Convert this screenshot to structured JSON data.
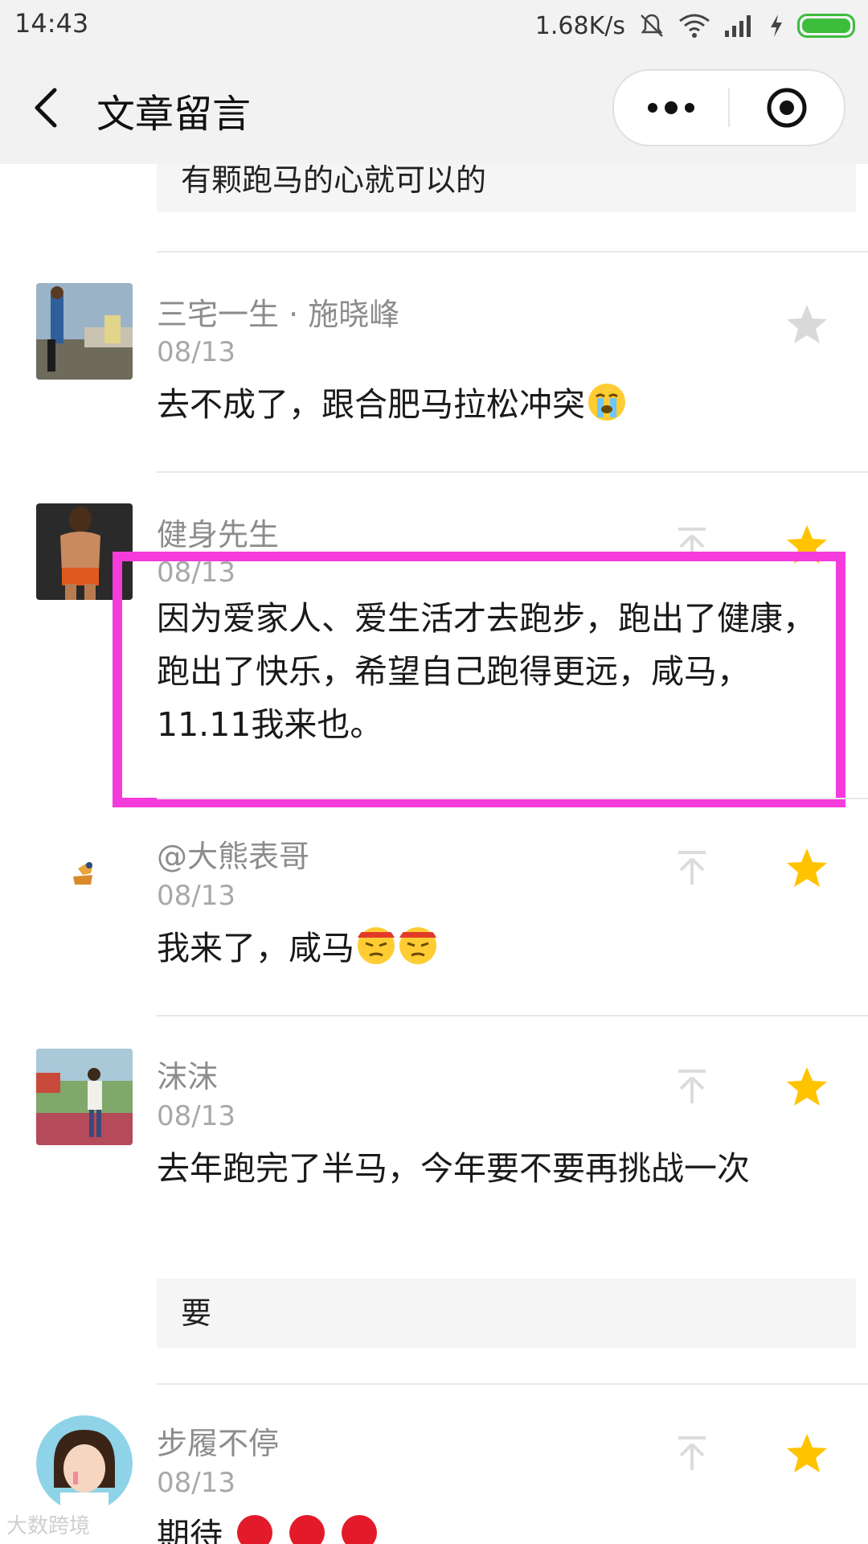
{
  "status_bar": {
    "time": "14:43",
    "speed": "1.68K/s",
    "battery_color": "#3cbd3c"
  },
  "nav": {
    "title": "文章留言",
    "back_icon": "chevron-left-icon",
    "more_icon": "more-dots-icon",
    "close_icon": "target-close-icon"
  },
  "top_reply": {
    "text": "有颗跑马的心就可以的"
  },
  "comments": [
    {
      "nickname": "三宅一生 · 施晓峰",
      "date": "08/13",
      "text": "去不成了，跟合肥马拉松冲突",
      "emoji": "crying-face-icon",
      "starred": false
    },
    {
      "nickname": "健身先生",
      "date": "08/13",
      "text": "因为爱家人、爱生活才去跑步，跑出了健康，跑出了快乐，希望自己跑得更远，咸马，11.11我来也。",
      "starred": true
    },
    {
      "nickname": "@大熊表哥",
      "date": "08/13",
      "text": "我来了，咸马",
      "emoji": "determined-face-icon",
      "starred": true
    },
    {
      "nickname": "沫沫",
      "date": "08/13",
      "text": "去年跑完了半马，今年要不要再挑战一次",
      "reply": "要",
      "starred": true
    },
    {
      "nickname": "步履不停",
      "date": "08/13",
      "text": "期待",
      "emoji": "red-balloon-icon",
      "starred": true
    }
  ],
  "colors": {
    "highlight": "#f43bdc",
    "star_active": "#ffc300",
    "star_inactive": "#d9d9d9"
  },
  "watermark": "大数跨境"
}
